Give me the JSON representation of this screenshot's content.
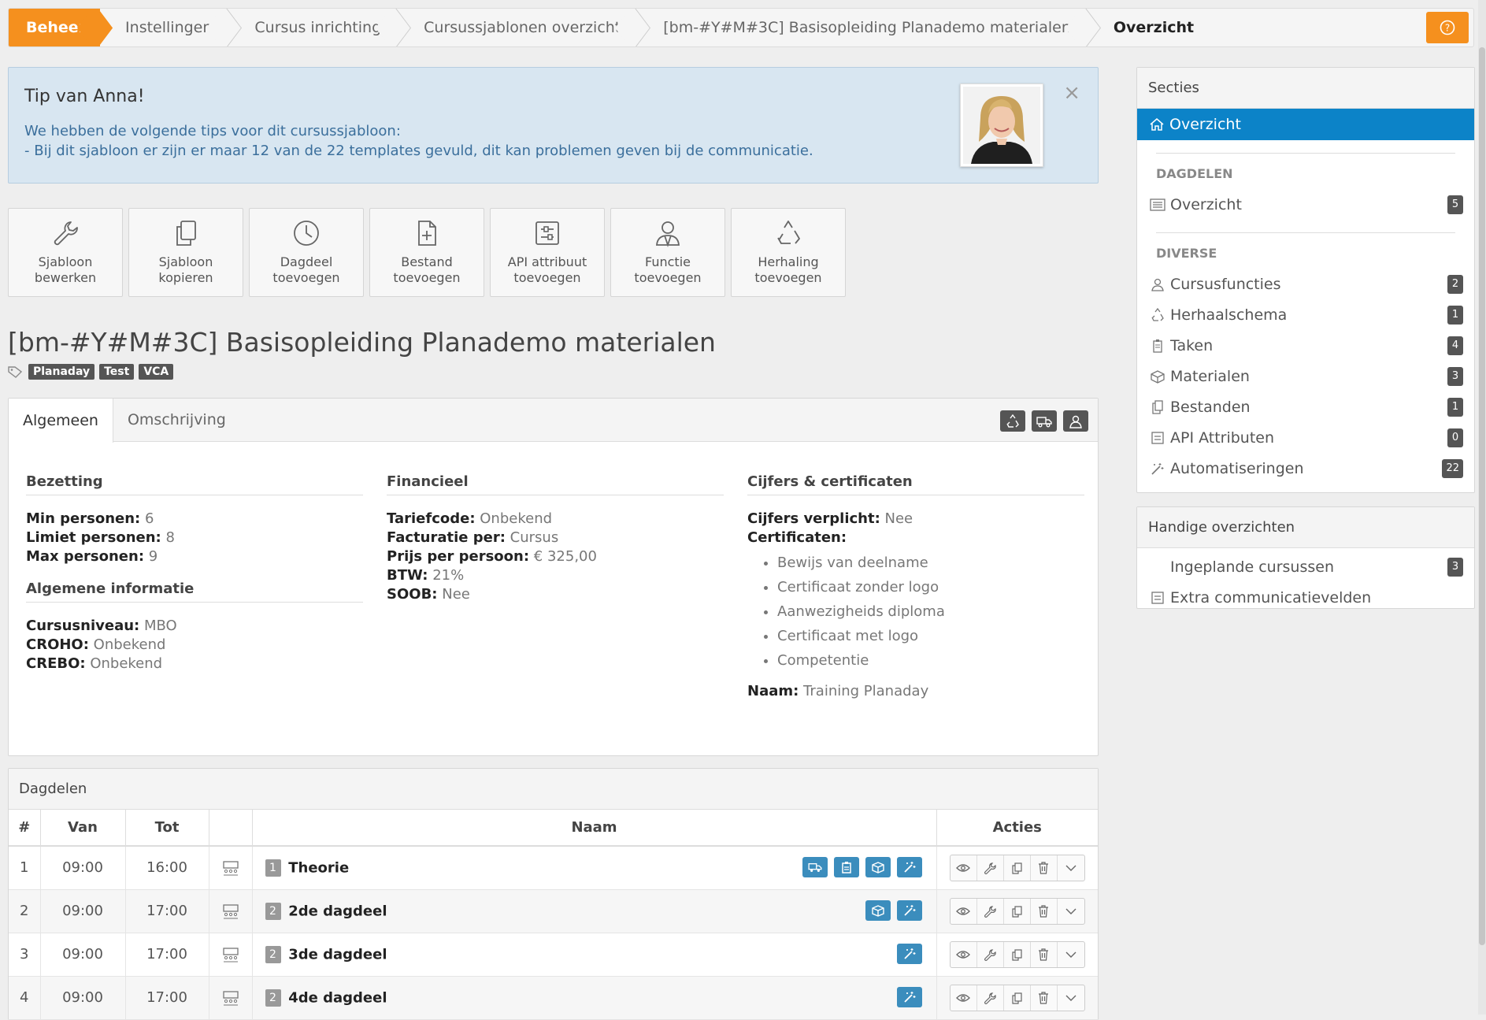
{
  "breadcrumb": [
    "Beheer",
    "Instellingen",
    "Cursus inrichting",
    "Cursussjablonen overzicht",
    "[bm-#Y#M#3C] Basisopleiding Planademo materialen",
    "Overzicht"
  ],
  "tip": {
    "title": "Tip van Anna!",
    "line1": "We hebben de volgende tips voor dit cursussjabloon:",
    "line2": "- Bij dit sjabloon er zijn er maar 12 van de 22 templates gevuld, dit kan problemen geven bij de communicatie.",
    "close": "×"
  },
  "actions": [
    {
      "line1": "Sjabloon",
      "line2": "bewerken",
      "icon": "wrench-icon"
    },
    {
      "line1": "Sjabloon",
      "line2": "kopieren",
      "icon": "copy-icon"
    },
    {
      "line1": "Dagdeel",
      "line2": "toevoegen",
      "icon": "clock-icon"
    },
    {
      "line1": "Bestand",
      "line2": "toevoegen",
      "icon": "file-plus-icon"
    },
    {
      "line1": "API attribuut",
      "line2": "toevoegen",
      "icon": "api-icon"
    },
    {
      "line1": "Functie",
      "line2": "toevoegen",
      "icon": "user-icon"
    },
    {
      "line1": "Herhaling",
      "line2": "toevoegen",
      "icon": "recycle-icon"
    }
  ],
  "title": "[bm-#Y#M#3C] Basisopleiding Planademo materialen",
  "tags": [
    "Planaday",
    "Test",
    "VCA"
  ],
  "tabs": [
    "Algemeen",
    "Omschrijving"
  ],
  "bezetting": {
    "heading": "Bezetting",
    "items": [
      {
        "label": "Min personen:",
        "value": "6"
      },
      {
        "label": "Limiet personen:",
        "value": "8"
      },
      {
        "label": "Max personen:",
        "value": "9"
      }
    ]
  },
  "algemeen": {
    "heading": "Algemene informatie",
    "items": [
      {
        "label": "Cursusniveau:",
        "value": "MBO"
      },
      {
        "label": "CROHO:",
        "value": "Onbekend"
      },
      {
        "label": "CREBO:",
        "value": "Onbekend"
      }
    ]
  },
  "financieel": {
    "heading": "Financieel",
    "items": [
      {
        "label": "Tariefcode:",
        "value": "Onbekend"
      },
      {
        "label": "Facturatie per:",
        "value": "Cursus"
      },
      {
        "label": "Prijs per persoon:",
        "value": "€ 325,00"
      },
      {
        "label": "BTW:",
        "value": "21%"
      },
      {
        "label": "SOOB:",
        "value": "Nee"
      }
    ]
  },
  "cijfers": {
    "heading": "Cijfers & certificaten",
    "verplicht_label": "Cijfers verplicht:",
    "verplicht_value": "Nee",
    "certificaten_label": "Certificaten:",
    "certificaten": [
      "Bewijs van deelname",
      "Certificaat zonder logo",
      "Aanwezigheids diploma",
      "Certificaat met logo",
      "Competentie"
    ],
    "naam_label": "Naam:",
    "naam_value": "Training Planaday"
  },
  "dagdelen": {
    "heading": "Dagdelen",
    "columns": [
      "#",
      "Van",
      "Tot",
      "",
      "Naam",
      "Acties"
    ],
    "rows": [
      {
        "nr": "1",
        "van": "09:00",
        "tot": "16:00",
        "badge": "1",
        "naam": "Theorie"
      },
      {
        "nr": "2",
        "van": "09:00",
        "tot": "17:00",
        "badge": "2",
        "naam": "2de dagdeel"
      },
      {
        "nr": "3",
        "van": "09:00",
        "tot": "17:00",
        "badge": "2",
        "naam": "3de dagdeel"
      },
      {
        "nr": "4",
        "van": "09:00",
        "tot": "17:00",
        "badge": "2",
        "naam": "4de dagdeel"
      }
    ]
  },
  "sidebar": {
    "heading": "Secties",
    "active": "Overzicht",
    "group1": "DAGDELEN",
    "group1_items": [
      {
        "label": "Overzicht",
        "count": "5"
      }
    ],
    "group2": "DIVERSE",
    "group2_items": [
      {
        "label": "Cursusfuncties",
        "count": "2"
      },
      {
        "label": "Herhaalschema",
        "count": "1"
      },
      {
        "label": "Taken",
        "count": "4"
      },
      {
        "label": "Materialen",
        "count": "3"
      },
      {
        "label": "Bestanden",
        "count": "1"
      },
      {
        "label": "API Attributen",
        "count": "0"
      },
      {
        "label": "Automatiseringen",
        "count": "22"
      }
    ],
    "handige_heading": "Handige overzichten",
    "handige_items": [
      {
        "label": "Ingeplande cursussen",
        "count": "3"
      },
      {
        "label": "Extra communicatievelden",
        "count": ""
      }
    ]
  },
  "colors": {
    "accent": "#f5901e",
    "active": "#0c83c8",
    "badge": "#3b8dbd"
  }
}
